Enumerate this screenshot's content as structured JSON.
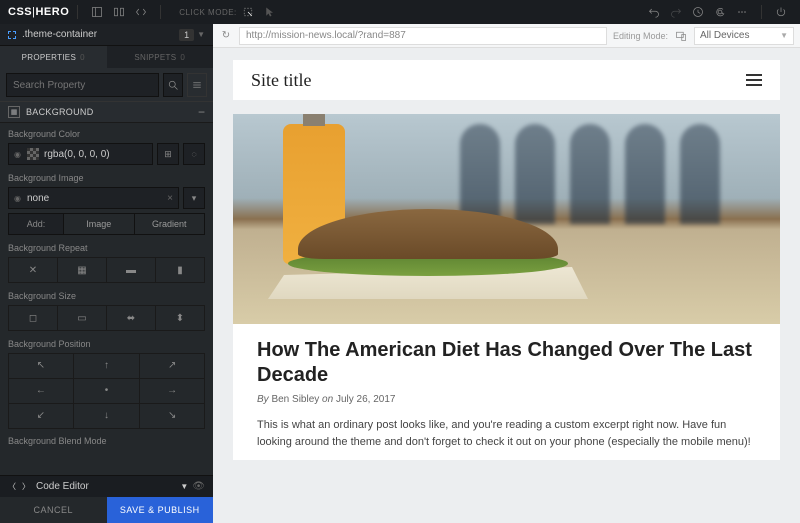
{
  "brand": {
    "part1": "CSS",
    "part2": "HERO"
  },
  "topbar": {
    "click_mode_label": "CLICK MODE:"
  },
  "selector": {
    "text": ".theme-container",
    "count": "1"
  },
  "tabs": {
    "properties": "PROPERTIES",
    "properties_count": "0",
    "snippets": "SNIPPETS",
    "snippets_count": "0"
  },
  "search": {
    "placeholder": "Search Property"
  },
  "section": {
    "background": "BACKGROUND"
  },
  "bg_color": {
    "label": "Background Color",
    "value": "rgba(0, 0, 0, 0)"
  },
  "bg_image": {
    "label": "Background Image",
    "value": "none",
    "add_label": "Add:",
    "image_btn": "Image",
    "gradient_btn": "Gradient"
  },
  "bg_repeat": {
    "label": "Background Repeat"
  },
  "bg_size": {
    "label": "Background Size"
  },
  "bg_position": {
    "label": "Background Position"
  },
  "bg_blend": {
    "label": "Background Blend Mode"
  },
  "code_editor": {
    "label": "Code Editor"
  },
  "actions": {
    "cancel": "CANCEL",
    "publish": "SAVE & PUBLISH"
  },
  "urlbar": {
    "url": "http://mission-news.local/?rand=887",
    "edit_mode": "Editing Mode:",
    "device": "All Devices"
  },
  "site": {
    "title": "Site title"
  },
  "post": {
    "title": "How The American Diet Has Changed Over The Last Decade",
    "by": "By",
    "author": "Ben Sibley",
    "on": "on",
    "date": "July 26, 2017",
    "excerpt": "This is what an ordinary post looks like, and you're reading a custom excerpt right now. Have fun looking around the theme and don't forget to check it out on your phone (especially the mobile menu)!"
  }
}
